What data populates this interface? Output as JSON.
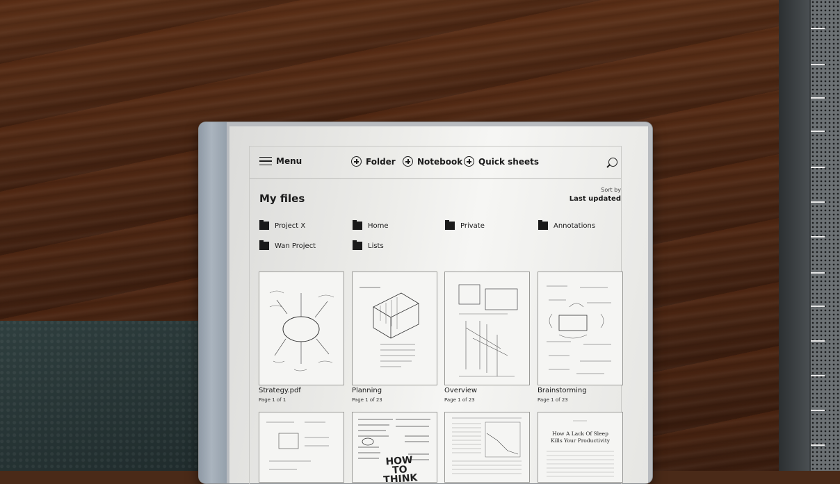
{
  "toolbar": {
    "menu_label": "Menu",
    "folder_label": "Folder",
    "notebook_label": "Notebook",
    "quick_sheets_label": "Quick sheets"
  },
  "header": {
    "title": "My files",
    "sort_label": "Sort by",
    "sort_value": "Last updated"
  },
  "folders": [
    {
      "label": "Project X"
    },
    {
      "label": "Home"
    },
    {
      "label": "Private"
    },
    {
      "label": "Annotations"
    },
    {
      "label": "Wan Project"
    },
    {
      "label": "Lists"
    }
  ],
  "documents": [
    {
      "name": "Strategy.pdf",
      "pages": "Page 1 of 1"
    },
    {
      "name": "Planning",
      "pages": "Page 1 of 23"
    },
    {
      "name": "Overview",
      "pages": "Page 1 of 23"
    },
    {
      "name": "Brainstorming",
      "pages": "Page 1 of 23"
    }
  ],
  "second_row": {
    "sketch_title": "HOW TO THINK",
    "doc_title_line1": "How A Lack Of Sleep",
    "doc_title_line2": "Kills Your Productivity"
  }
}
